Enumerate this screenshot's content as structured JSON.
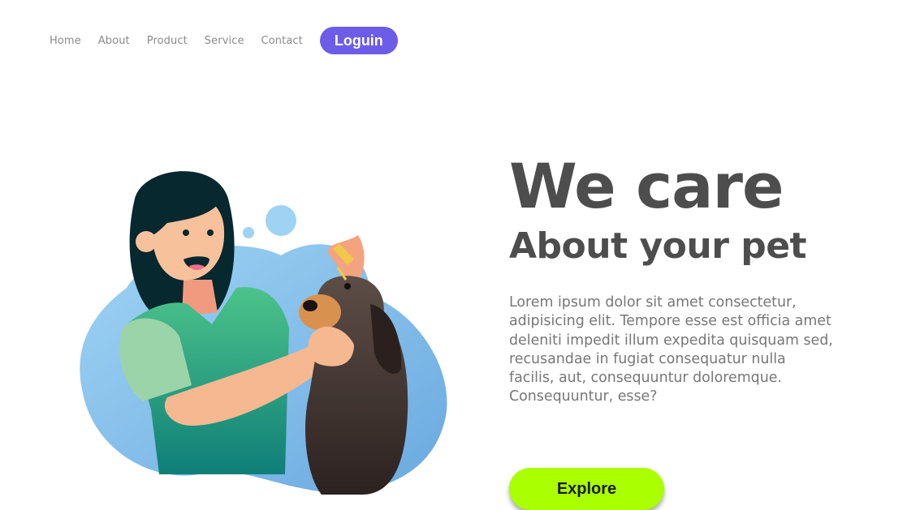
{
  "nav": {
    "links": [
      "Home",
      "About",
      "Product",
      "Service",
      "Contact"
    ],
    "login_label": "Loguin"
  },
  "hero": {
    "title": "We care",
    "subtitle": "About your pet",
    "body": "Lorem ipsum dolor sit amet consectetur, adipisicing elit. Tempore esse est officia amet deleniti impedit illum expedita quisquam sed, recusandae in fugiat consequatur nulla facilis, aut, consequuntur doloremque. Consequuntur, esse?",
    "cta_label": "Explore"
  },
  "colors": {
    "accent": "#6c5ce7",
    "cta": "#aaff00",
    "blob": "#8cc4ec",
    "scrub": "#2eaa84"
  },
  "illustration": {
    "icon": "woman-with-dog-illustration"
  }
}
